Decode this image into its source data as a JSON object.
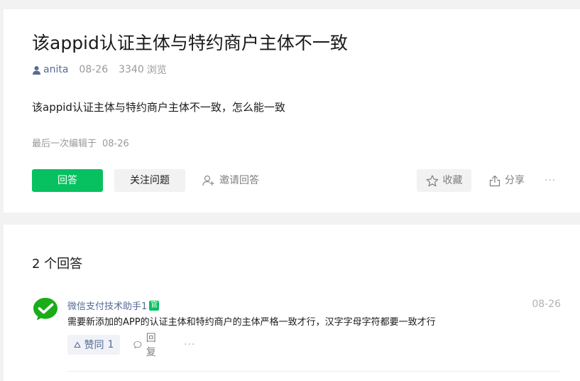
{
  "question": {
    "title": "该appid认证主体与特约商户主体不一致",
    "author": "anita",
    "date": "08-26",
    "views": "3340",
    "views_label": "浏览",
    "body": "该appid认证主体与特约商户主体不一致，怎么能一致",
    "edited_label": "最后一次编辑于",
    "edited_date": "08-26"
  },
  "actions": {
    "answer_label": "回答",
    "follow_label": "关注问题",
    "invite_label": "邀请回答",
    "collect_label": "收藏",
    "share_label": "分享",
    "more_label": "···"
  },
  "answers": {
    "count_label": "2 个回答",
    "items": [
      {
        "user": "微信支付技术助手1",
        "badge": "官",
        "date": "08-26",
        "text": "需要新添加的APP的认证主体和特约商户的主体严格一致才行，汉字字母字符都要一致才行",
        "like_label": "赞同",
        "like_count": "1",
        "reply_label": "回复",
        "more_label": "···"
      }
    ]
  },
  "icons": {
    "author": "user-icon",
    "invite": "add-user-icon",
    "collect": "star-icon",
    "share": "share-icon",
    "like": "thumb-up-icon",
    "reply": "comment-icon",
    "avatar": "wechat-pay-logo-icon"
  },
  "colors": {
    "brand_green": "#07c160",
    "link_blue": "#576b95",
    "text": "#1a1a1a",
    "muted": "#999999",
    "light_bg": "#f2f2f2"
  }
}
